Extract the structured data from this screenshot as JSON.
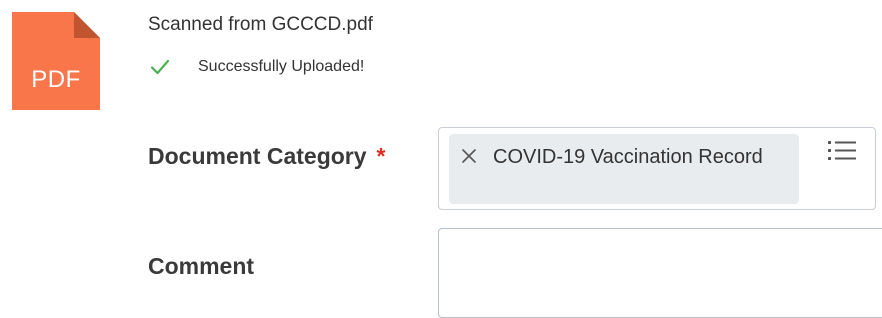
{
  "file": {
    "icon": "pdf-file-icon",
    "type_label": "PDF",
    "icon_color": "#f8764a",
    "name": "Scanned from GCCCD.pdf",
    "status_icon": "check-icon",
    "status_color": "#4caf50",
    "status_text": "Successfully Uploaded!"
  },
  "form": {
    "document_category": {
      "label": "Document Category",
      "required_marker": "*",
      "required_color": "#de2e21",
      "selected_value": "COVID-19 Vaccination Record",
      "remove_icon": "close-icon",
      "prompt_icon": "list-icon"
    },
    "comment": {
      "label": "Comment",
      "value": ""
    }
  }
}
